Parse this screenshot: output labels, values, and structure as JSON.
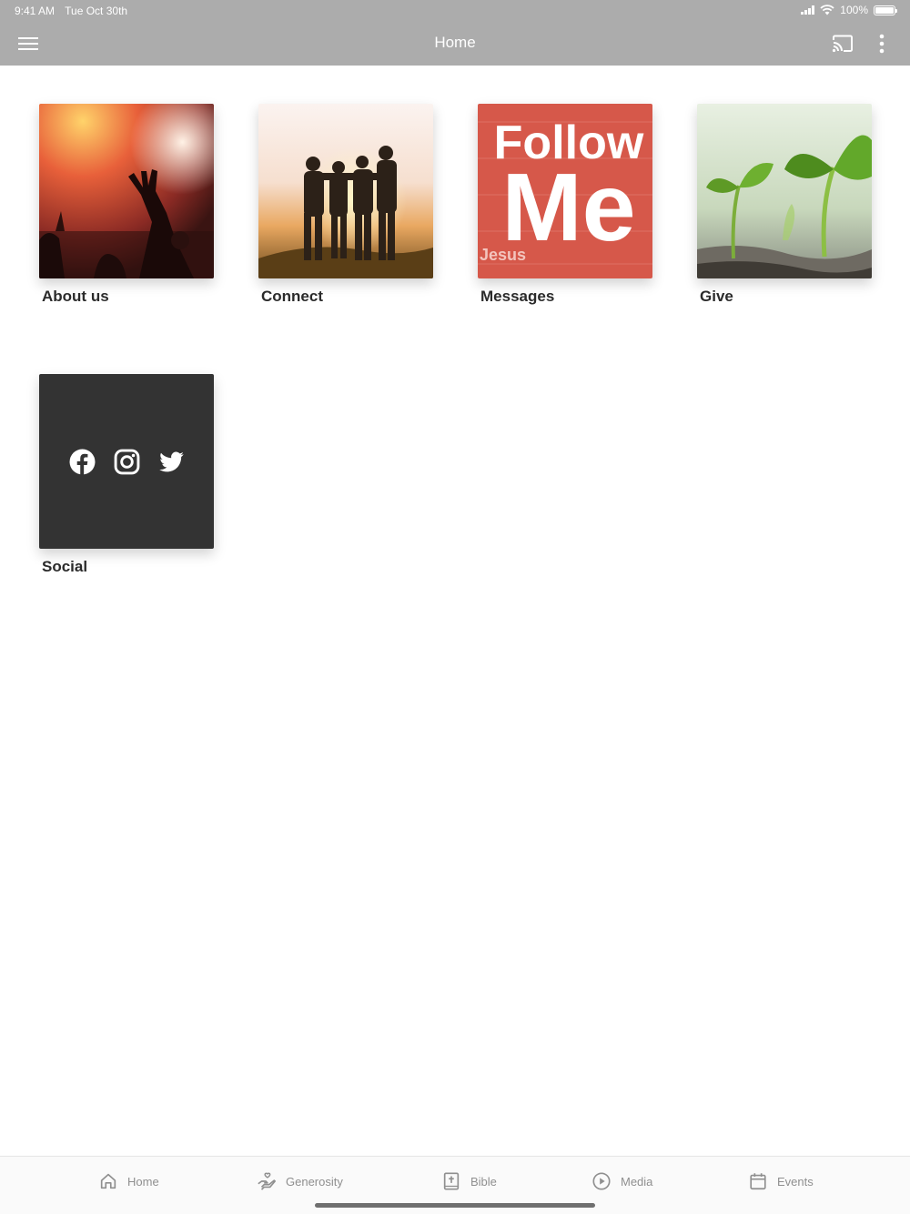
{
  "status_bar": {
    "time": "9:41 AM",
    "date": "Tue Oct 30th",
    "battery": "100%",
    "icons": [
      "signal-icon",
      "wifi-icon",
      "battery-icon"
    ]
  },
  "nav_bar": {
    "title": "Home",
    "background": "#acacac",
    "icons": [
      "menu-icon",
      "cast-icon",
      "more-vertical-icon"
    ]
  },
  "tiles": [
    {
      "label": "About us"
    },
    {
      "label": "Connect"
    },
    {
      "label": "Messages",
      "image_text": {
        "line1": "Follow",
        "line2": "Me",
        "line3": "Jesus"
      },
      "color": "#d6584a"
    },
    {
      "label": "Give"
    },
    {
      "label": "Social",
      "icons": [
        "facebook-icon",
        "instagram-icon",
        "twitter-icon"
      ],
      "color": "#333333"
    }
  ],
  "tab_bar": {
    "tabs": [
      {
        "label": "Home",
        "icon": "home-icon"
      },
      {
        "label": "Generosity",
        "icon": "hand-heart-icon"
      },
      {
        "label": "Bible",
        "icon": "bible-icon"
      },
      {
        "label": "Media",
        "icon": "play-circle-icon"
      },
      {
        "label": "Events",
        "icon": "calendar-icon"
      }
    ]
  }
}
